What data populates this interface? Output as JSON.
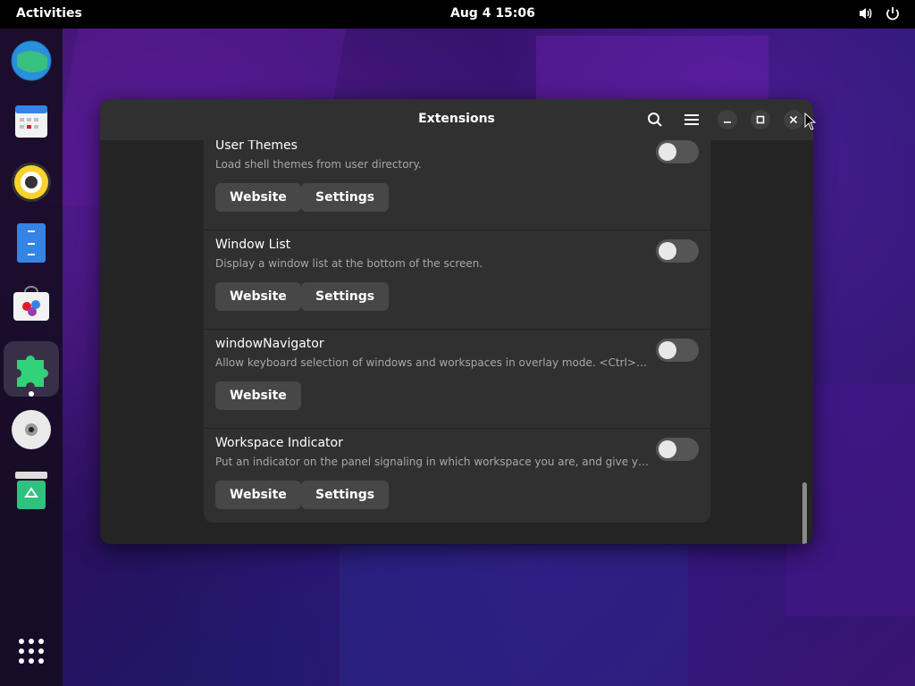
{
  "topbar": {
    "activities": "Activities",
    "clock": "Aug 4  15:06",
    "icons": [
      "volume-icon",
      "power-icon"
    ]
  },
  "dock": {
    "apps": [
      "web-browser",
      "calendar",
      "rhythmbox",
      "files",
      "software",
      "extensions",
      "disc",
      "trash"
    ],
    "active_app": "extensions",
    "app_grid_icon": "app-grid-icon"
  },
  "window": {
    "title": "Extensions",
    "header_icons": [
      "search-icon",
      "menu-icon",
      "minimize-icon",
      "maximize-icon",
      "close-icon"
    ],
    "extensions": [
      {
        "name": "User Themes",
        "description": "Load shell themes from user directory.",
        "enabled": false,
        "website_label": "Website",
        "settings_label": "Settings"
      },
      {
        "name": "Window List",
        "description": "Display a window list at the bottom of the screen.",
        "enabled": false,
        "website_label": "Website",
        "settings_label": "Settings"
      },
      {
        "name": "windowNavigator",
        "description": "Allow keyboard selection of windows and workspaces in overlay mode. <Ctrl>number sel…",
        "enabled": false,
        "website_label": "Website"
      },
      {
        "name": "Workspace Indicator",
        "description": "Put an indicator on the panel signaling in which workspace you are, and give you the poss…",
        "enabled": false,
        "website_label": "Website",
        "settings_label": "Settings"
      }
    ]
  },
  "colors": {
    "window_bg": "#242424",
    "card_bg": "#303030",
    "button_bg": "#474747",
    "toggle_off": "#555555"
  }
}
